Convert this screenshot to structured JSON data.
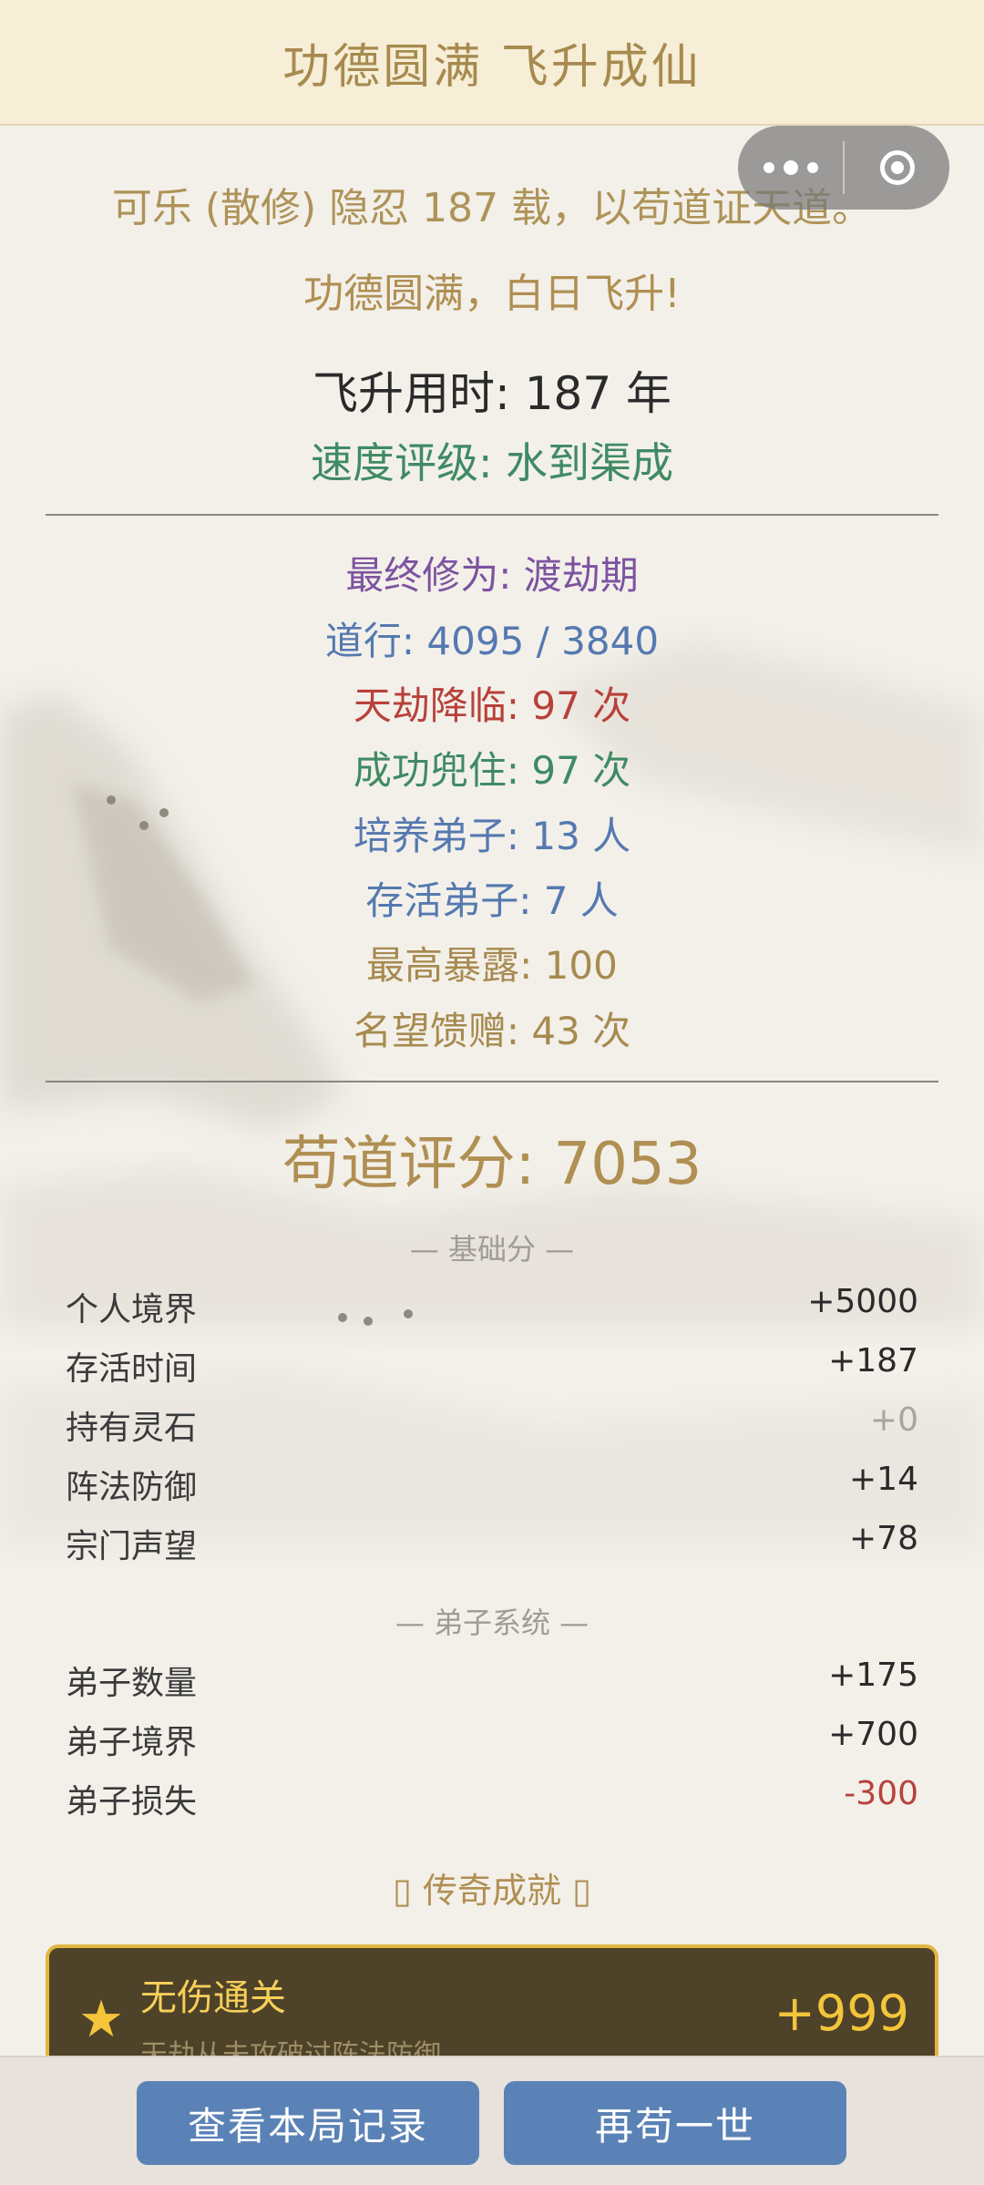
{
  "header": {
    "title": "功德圆满 飞升成仙"
  },
  "capsule": {
    "more_icon": "more-dots-icon",
    "close_icon": "target-close-icon"
  },
  "summary": {
    "intro": "可乐 (散修) 隐忍 187 载，以苟道证天道。",
    "ascension": "功德圆满，白日飞升!",
    "time": "飞升用时: 187 年",
    "speed_rating": "速度评级: 水到渠成"
  },
  "stats": [
    {
      "text": "最终修为: 渡劫期",
      "color": "#7d53a0"
    },
    {
      "text": "道行: 4095 / 3840",
      "color": "#5579b0"
    },
    {
      "text": "天劫降临: 97 次",
      "color": "#b8413a"
    },
    {
      "text": "成功兜住: 97 次",
      "color": "#3f8a64"
    },
    {
      "text": "培养弟子: 13 人",
      "color": "#5579b0"
    },
    {
      "text": "存活弟子: 7 人",
      "color": "#5579b0"
    },
    {
      "text": "最高暴露: 100",
      "color": "#a78a4f"
    },
    {
      "text": "名望馈赠: 43 次",
      "color": "#a78a4f"
    }
  ],
  "score": {
    "title": "苟道评分: 7053"
  },
  "base_section": {
    "label": "— 基础分 —",
    "rows": [
      {
        "label": "个人境界",
        "value": "+5000",
        "color": "#2a2a2a"
      },
      {
        "label": "存活时间",
        "value": "+187",
        "color": "#2a2a2a"
      },
      {
        "label": "持有灵石",
        "value": "+0",
        "color": "#a9a59e"
      },
      {
        "label": "阵法防御",
        "value": "+14",
        "color": "#2a2a2a"
      },
      {
        "label": "宗门声望",
        "value": "+78",
        "color": "#2a2a2a"
      }
    ]
  },
  "disciple_section": {
    "label": "— 弟子系统 —",
    "rows": [
      {
        "label": "弟子数量",
        "value": "+175",
        "color": "#2a2a2a"
      },
      {
        "label": "弟子境界",
        "value": "+700",
        "color": "#2a2a2a"
      },
      {
        "label": "弟子损失",
        "value": "-300",
        "color": "#b8413a"
      }
    ]
  },
  "achievements": {
    "label": "▯  传奇成就 ▯",
    "items": [
      {
        "name": "无伤通关",
        "desc": "天劫从未攻破过阵法防御",
        "points": "+999"
      }
    ]
  },
  "footer": {
    "record_button": "查看本局记录",
    "again_button": "再苟一世"
  }
}
